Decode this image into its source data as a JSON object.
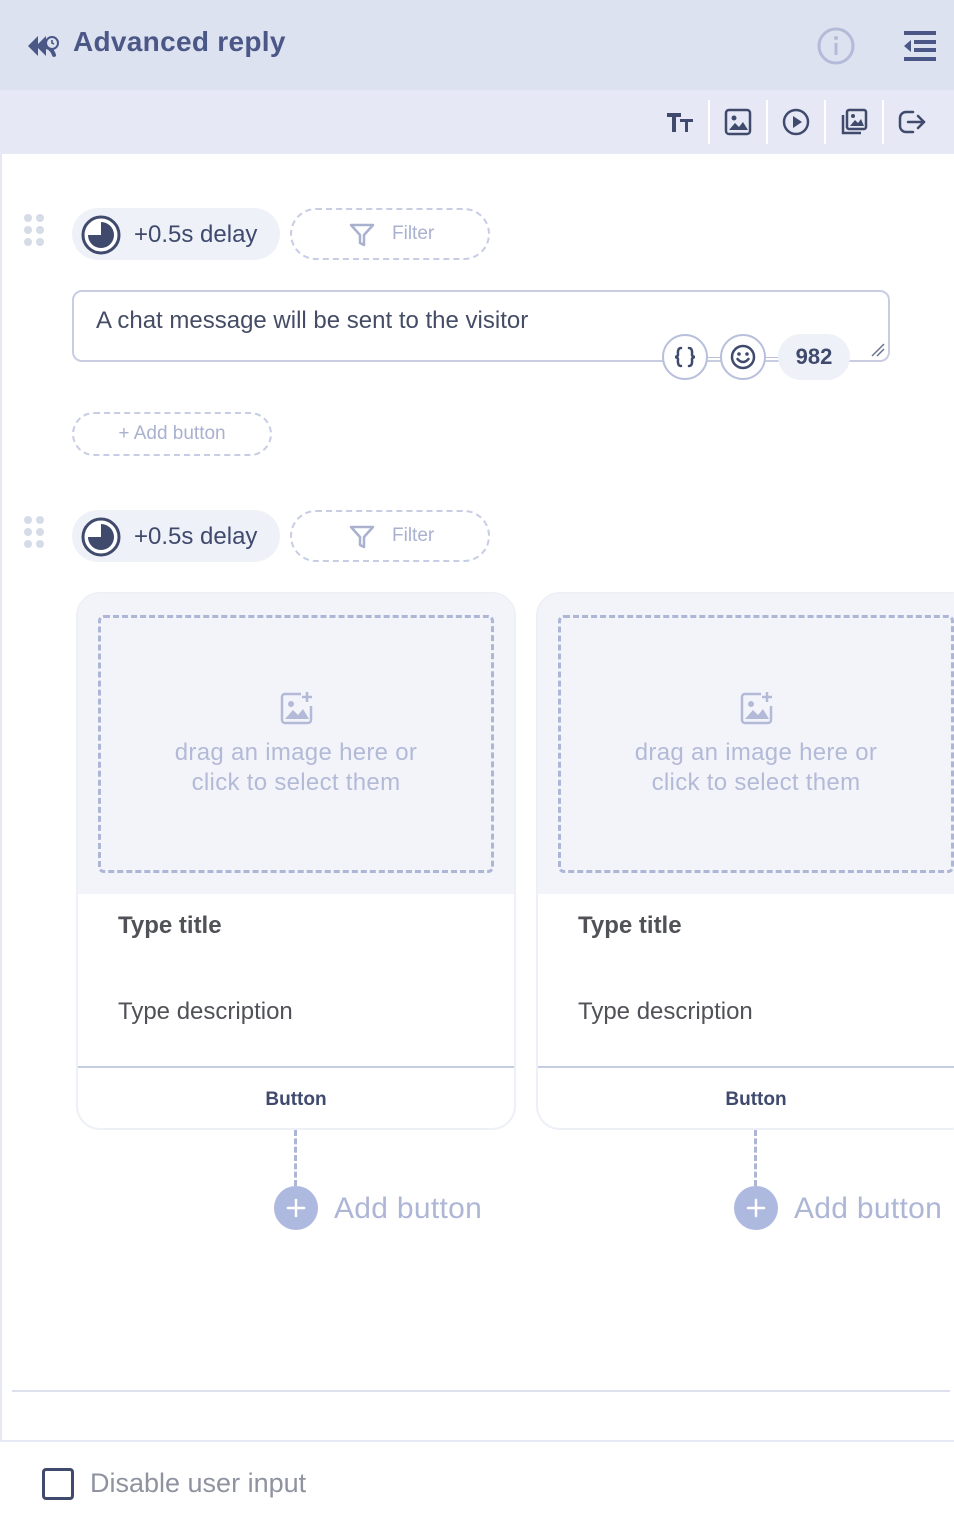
{
  "header": {
    "title": "Advanced reply",
    "back_icon": "reply-all-icon",
    "info_icon": "info-icon",
    "menu_icon": "collapse-menu-icon"
  },
  "toolbar": {
    "tools": [
      "text-icon",
      "image-icon",
      "play-icon",
      "gallery-icon",
      "redirect-icon"
    ]
  },
  "blocks": [
    {
      "delay_label": "+0.5s delay",
      "filter_label": "Filter",
      "message_text": "A chat message will be sent to the visitor",
      "char_count": "982",
      "add_button_label": "+ Add button"
    },
    {
      "delay_label": "+0.5s delay",
      "filter_label": "Filter",
      "cards": [
        {
          "dropzone_text_line1": "drag an image here or",
          "dropzone_text_line2": "click to select them",
          "title": "Type title",
          "description": "Type description",
          "button_label": "Button",
          "add_button_label": "Add button"
        },
        {
          "dropzone_text_line1": "drag an image here or",
          "dropzone_text_line2": "click to select them",
          "title": "Type title",
          "description": "Type description",
          "button_label": "Button",
          "add_button_label": "Add button"
        }
      ]
    }
  ],
  "footer": {
    "checkbox_label": "Disable user input",
    "checked": false
  },
  "colors": {
    "header_bg": "#dde2f0",
    "toolbar_bg": "#e6e9f5",
    "accent": "#4a5787",
    "muted": "#aeb6d6"
  }
}
